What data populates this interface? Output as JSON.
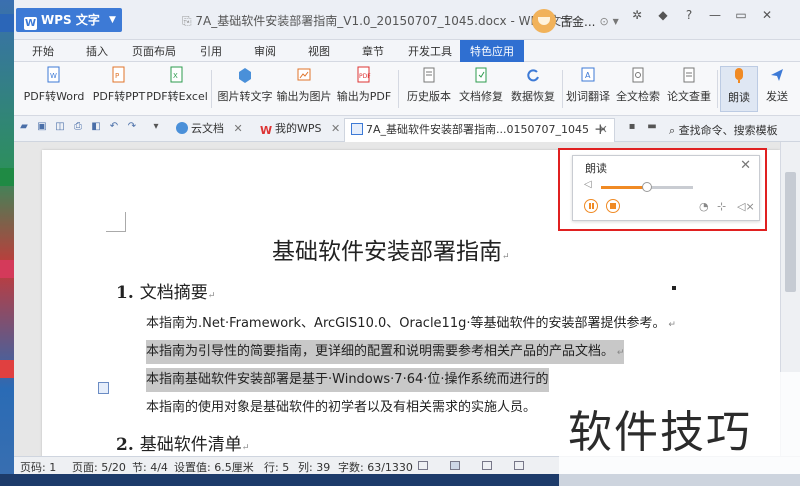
{
  "app": {
    "name": "WPS 文字",
    "doc_title": "7A_基础软件安装部署指南_V1.0_20150707_1045.docx - WPS 文字",
    "user": "古金..."
  },
  "menu_tabs": [
    "开始",
    "插入",
    "页面布局",
    "引用",
    "审阅",
    "视图",
    "章节",
    "开发工具",
    "特色应用"
  ],
  "ribbon": {
    "pdf_to_word": "PDF转Word",
    "pdf_to_ppt": "PDF转PPT",
    "pdf_to_excel": "PDF转Excel",
    "image_to_text": "图片转文字",
    "export_image": "输出为图片",
    "export_pdf": "输出为PDF",
    "history": "历史版本",
    "repair": "文档修复",
    "recover": "数据恢复",
    "translate": "划词翻译",
    "fulltext_search": "全文检索",
    "paper_check": "论文查重",
    "read_aloud": "朗读",
    "send": "发送"
  },
  "doc_tabs": {
    "cloud": "云文档",
    "mywps": "我的WPS",
    "current": "7A_基础软件安装部署指南...0150707_1045"
  },
  "search_cmd": "查找命令、搜索模板",
  "document": {
    "title": "基础软件安装部署指南",
    "s1_num": "1.",
    "s1_title": "文档摘要",
    "p1": "本指南为.Net·Framework、ArcGIS10.0、Oracle11g·等基础软件的安装部署提供参考。",
    "p2": "本指南为引导性的简要指南，更详细的配置和说明需要参考相关产品的产品文档。",
    "p3": "本指南基础软件安装部署是基于·Windows·7·64·位·操作系统而进行的",
    "p4": "本指南的使用对象是基础软件的初学者以及有相关需求的实施人员。",
    "s2_num": "2.",
    "s2_title": "基础软件清单"
  },
  "read_panel": {
    "title": "朗读",
    "volume": 0.5
  },
  "status": {
    "page_num": "页码: 1",
    "page": "页面: 5/20",
    "section": "节: 4/4",
    "set_value": "设置值: 6.5厘米",
    "row": "行: 5",
    "col": "列: 39",
    "words": "字数: 63/1330"
  },
  "watermark": "软件技巧",
  "colors": {
    "accent": "#2f6fd1",
    "read_orange": "#f08a24",
    "highlight_frame": "#e02020"
  }
}
